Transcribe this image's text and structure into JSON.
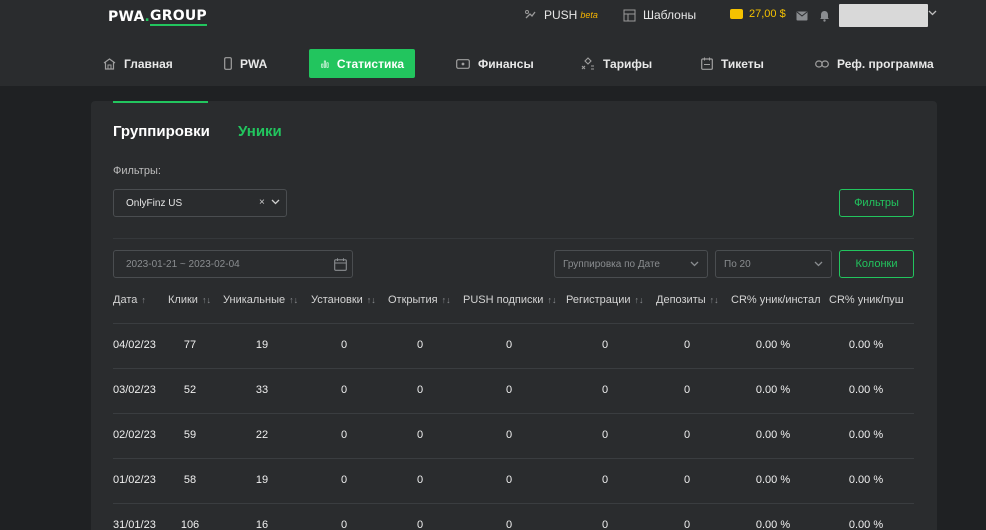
{
  "header": {
    "logo_main": "PWA",
    "logo_dot": ".",
    "logo_accent": "GROUP",
    "push_label": "PUSH",
    "push_badge": "beta",
    "templates_label": "Шаблоны",
    "balance": "27,00 $",
    "accent_color": "#22c55e",
    "balance_color": "#f5c200"
  },
  "nav": {
    "items": [
      {
        "label": "Главная",
        "icon": "home-icon"
      },
      {
        "label": "PWA",
        "icon": "phone-icon"
      },
      {
        "label": "Статистика",
        "icon": "chart-icon",
        "active": true
      },
      {
        "label": "Финансы",
        "icon": "wallet-icon"
      },
      {
        "label": "Тарифы",
        "icon": "tariffs-icon"
      },
      {
        "label": "Тикеты",
        "icon": "tickets-icon"
      },
      {
        "label": "Реф. программа",
        "icon": "link-icon"
      }
    ]
  },
  "tabs": {
    "groupings": "Группировки",
    "uniques": "Уники"
  },
  "filters": {
    "label": "Фильтры:",
    "selected": "OnlyFinz US",
    "clear": "×",
    "button": "Фильтры"
  },
  "controls": {
    "date_range": "2023-01-21 ~ 2023-02-04",
    "grouping": "Группировка по Дате",
    "per_page": "По 20",
    "columns_button": "Колонки"
  },
  "table": {
    "headers": [
      "Дата",
      "Клики",
      "Уникальные",
      "Установки",
      "Открытия",
      "PUSH подписки",
      "Регистрации",
      "Депозиты",
      "CR% уник/инстал",
      "CR% уник/пуш"
    ],
    "sort_asc": "↑",
    "sort_both": "↑↓",
    "rows": [
      [
        "04/02/23",
        "77",
        "19",
        "0",
        "0",
        "0",
        "0",
        "0",
        "0.00 %",
        "0.00 %"
      ],
      [
        "03/02/23",
        "52",
        "33",
        "0",
        "0",
        "0",
        "0",
        "0",
        "0.00 %",
        "0.00 %"
      ],
      [
        "02/02/23",
        "59",
        "22",
        "0",
        "0",
        "0",
        "0",
        "0",
        "0.00 %",
        "0.00 %"
      ],
      [
        "01/02/23",
        "58",
        "19",
        "0",
        "0",
        "0",
        "0",
        "0",
        "0.00 %",
        "0.00 %"
      ],
      [
        "31/01/23",
        "106",
        "16",
        "0",
        "0",
        "0",
        "0",
        "0",
        "0.00 %",
        "0.00 %"
      ]
    ]
  }
}
